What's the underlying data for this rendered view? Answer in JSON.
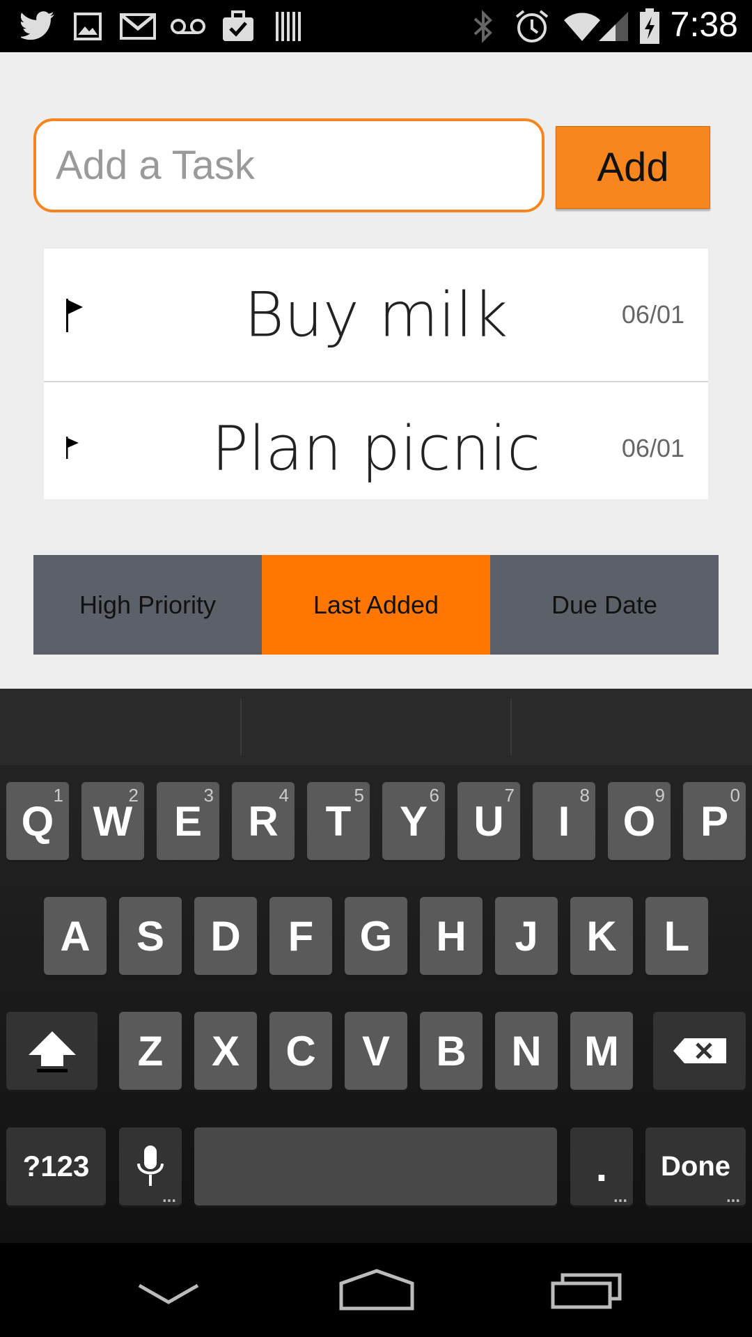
{
  "status_bar": {
    "time": "7:38",
    "left_icons": [
      "twitter-icon",
      "gallery-icon",
      "gmail-icon",
      "voicemail-icon",
      "tasks-icon",
      "barcode-icon"
    ],
    "right_icons": [
      "bluetooth-icon",
      "alarm-icon",
      "wifi-icon",
      "signal-icon",
      "battery-charging-icon"
    ]
  },
  "task_input": {
    "placeholder": "Add a Task",
    "value": ""
  },
  "add_button": {
    "label": "Add"
  },
  "tasks": [
    {
      "name": "Buy milk",
      "date": "06/01",
      "flag": "flag-icon"
    },
    {
      "name": "Plan picnic",
      "date": "06/01",
      "flag": "flag-icon"
    }
  ],
  "tabs": [
    {
      "label": "High Priority",
      "active": false
    },
    {
      "label": "Last Added",
      "active": true
    },
    {
      "label": "Due Date",
      "active": false
    }
  ],
  "keyboard": {
    "row1": [
      {
        "k": "Q",
        "h": "1"
      },
      {
        "k": "W",
        "h": "2"
      },
      {
        "k": "E",
        "h": "3"
      },
      {
        "k": "R",
        "h": "4"
      },
      {
        "k": "T",
        "h": "5"
      },
      {
        "k": "Y",
        "h": "6"
      },
      {
        "k": "U",
        "h": "7"
      },
      {
        "k": "I",
        "h": "8"
      },
      {
        "k": "O",
        "h": "9"
      },
      {
        "k": "P",
        "h": "0"
      }
    ],
    "row2": [
      "A",
      "S",
      "D",
      "F",
      "G",
      "H",
      "J",
      "K",
      "L"
    ],
    "row3": [
      "Z",
      "X",
      "C",
      "V",
      "B",
      "N",
      "M"
    ],
    "symbols_key": "?123",
    "period_key": ".",
    "done_key": "Done",
    "more_indicator": "..."
  },
  "colors": {
    "accent": "#ff7700",
    "tab_inactive": "#5c6169",
    "app_bg": "#eeeeee"
  }
}
